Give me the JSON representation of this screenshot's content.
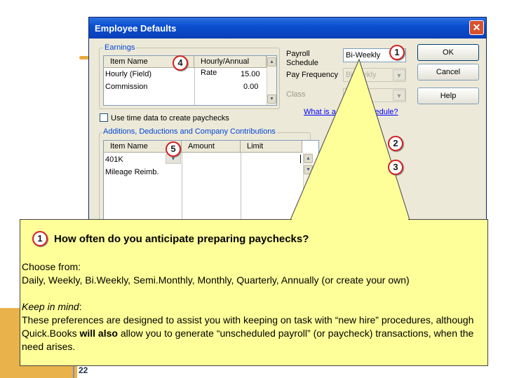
{
  "dialog": {
    "title": "Employee Defaults",
    "close_glyph": "✕"
  },
  "earnings": {
    "legend": "Earnings",
    "headers": [
      "Item Name",
      "Hourly/Annual Rate"
    ],
    "rows": [
      {
        "name": "Hourly (Field)",
        "rate": "15.00"
      },
      {
        "name": "Commission",
        "rate": "0.00"
      }
    ]
  },
  "payroll": {
    "schedule_label": "Payroll Schedule",
    "schedule_value": "Bi-Weekly",
    "frequency_label": "Pay Frequency",
    "frequency_value": "Biweekly",
    "class_label": "Class",
    "help_link": "What is a payroll schedule?"
  },
  "use_time_data": {
    "label": "Use time data to create paychecks",
    "checked": false
  },
  "additions": {
    "legend": "Additions, Deductions and Company Contributions",
    "headers": [
      "Item Name",
      "Amount",
      "Limit"
    ],
    "rows": [
      {
        "name": "401K",
        "amount": "",
        "limit": ""
      },
      {
        "name": "Mileage Reimb.",
        "amount": "",
        "limit": ""
      }
    ]
  },
  "buttons": {
    "ok": "OK",
    "cancel": "Cancel",
    "help": "Help"
  },
  "badges": [
    "1",
    "4",
    "5",
    "2",
    "3"
  ],
  "callout": {
    "badge": "1",
    "title": "How often do you anticipate preparing paychecks?",
    "choose_text": "Choose from:",
    "choices": "Daily, Weekly, Bi.Weekly, Semi.Monthly, Monthly, Quarterly, Annually (or create your own)",
    "keep_label": "Keep in mind",
    "keep_rest": ":",
    "body_pre": "These preferences are designed to assist you with keeping on task with “new hire” procedures, although Quick.Books ",
    "body_bold": "will also",
    "body_post": " allow you to generate “unscheduled payroll” (or paycheck) transactions, when the need arises."
  },
  "slide": {
    "page_number": "22"
  },
  "colors": {
    "callout_bg": "#ffff99",
    "titlebar": "#0a4fd0",
    "badge_ring": "#d21f1f",
    "legend_text": "#0046d5"
  }
}
